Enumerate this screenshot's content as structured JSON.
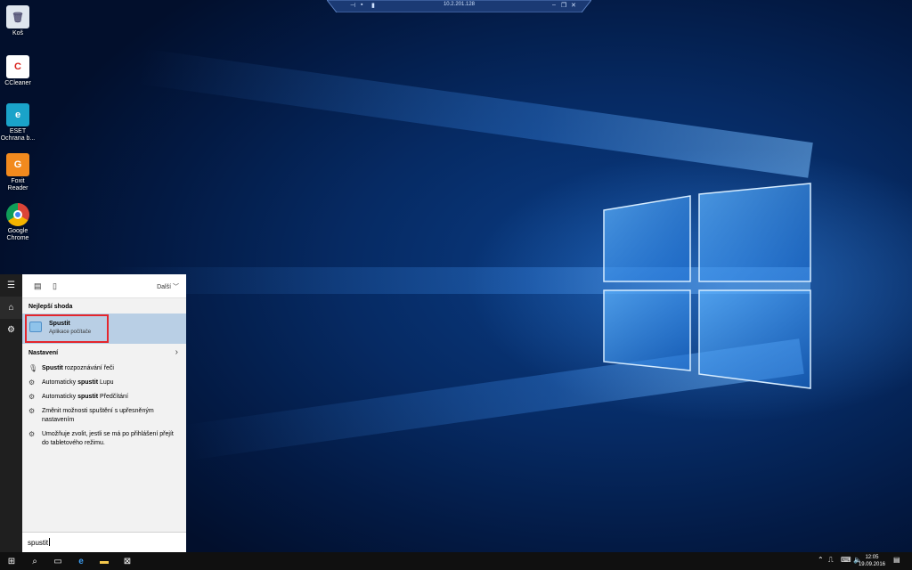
{
  "rdp": {
    "ip": "10.2.201.128"
  },
  "desktop_icons": [
    {
      "label": "Koš"
    },
    {
      "label": "CCleaner"
    },
    {
      "label": "ESET Ochrana b..."
    },
    {
      "label": "Foxit Reader"
    },
    {
      "label": "Google Chrome"
    }
  ],
  "search_panel": {
    "more_label": "Další",
    "best_match_header": "Nejlepší shoda",
    "best_match": {
      "title": "Spustit",
      "subtitle": "Aplikace počítače"
    },
    "settings_header": "Nastavení",
    "settings_items": [
      {
        "bold": "Spustit",
        "after": " rozpoznávání řeči",
        "before": ""
      },
      {
        "before": "Automaticky ",
        "bold": "spustit",
        "after": " Lupu"
      },
      {
        "before": "Automaticky ",
        "bold": "spustit",
        "after": " Předčítání"
      },
      {
        "before": "Změnit možnosti spuštění s upřesněným nastavením",
        "bold": "",
        "after": ""
      },
      {
        "before": "Umožňuje zvolit, jestli se má po přihlášení přejít do tabletového režimu.",
        "bold": "",
        "after": ""
      }
    ],
    "query": "spustit"
  },
  "taskbar": {
    "time": "12:05",
    "date": "19.09.2016"
  },
  "colors": {
    "accent": "#0078d7",
    "highlight": "#b9cfe5",
    "callout": "#e4262d"
  }
}
